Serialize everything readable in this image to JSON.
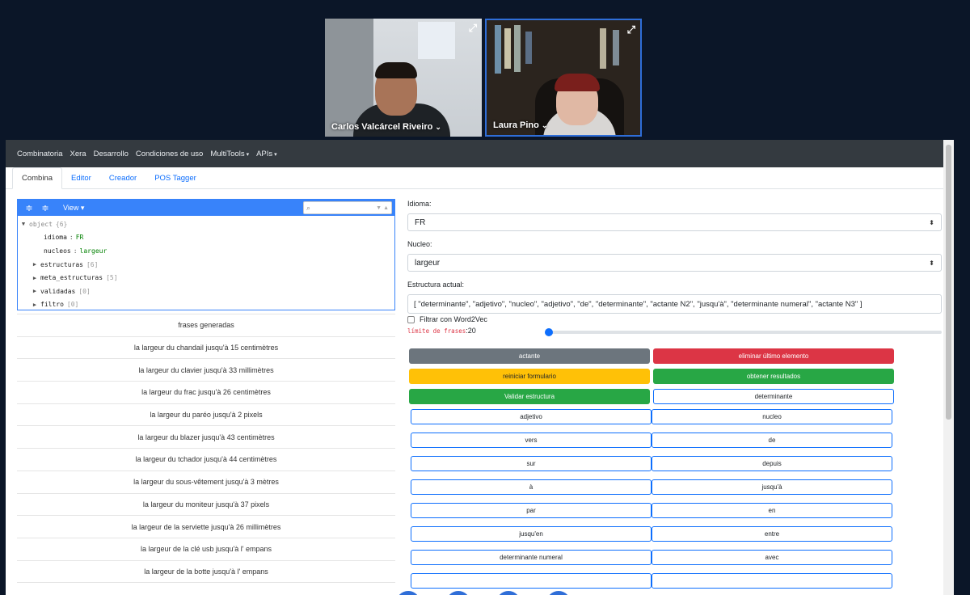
{
  "participants": [
    {
      "name": "Carlos Valcárcel Riveiro",
      "caret": "⌄"
    },
    {
      "name": "Laura Pino",
      "caret": "⌄"
    }
  ],
  "icons": {
    "expand": "⤢",
    "search": "⌕",
    "collapse_all": "≑",
    "expand_all": "≑",
    "sort_up": "▲",
    "sort_down": "▼",
    "select": "⬍",
    "tree_open": "▼",
    "tree_closed": "▶",
    "chevron": "▾"
  },
  "navbar": {
    "items": [
      "Combinatoria",
      "Xera",
      "Desarrollo",
      "Condiciones de uso",
      "MultiTools",
      "APIs"
    ]
  },
  "tabs": [
    "Combina",
    "Editor",
    "Creador",
    "POS Tagger"
  ],
  "json_editor": {
    "view_label": "View",
    "root": {
      "key": "object",
      "count": "{6}"
    },
    "fields": [
      {
        "key": "idioma",
        "value": "FR"
      },
      {
        "key": "nucleos",
        "value": "largeur"
      }
    ],
    "collapsed": [
      {
        "key": "estructuras",
        "count": "[6]"
      },
      {
        "key": "meta_estructuras",
        "count": "[5]"
      },
      {
        "key": "validadas",
        "count": "[0]"
      },
      {
        "key": "filtro",
        "count": "[0]"
      }
    ]
  },
  "results": {
    "header": "frases generadas",
    "rows": [
      "la largeur du chandail jusqu'à 15 centimètres",
      "la largeur du clavier jusqu'à 33 millimètres",
      "la largeur du frac jusqu'à 26 centimètres",
      "la largeur du paréo jusqu'à 2 pixels",
      "la largeur du blazer jusqu'à 43 centimètres",
      "la largeur du tchador jusqu'à 44 centimètres",
      "la largeur du sous-vêtement jusqu'à 3 mètres",
      "la largeur du moniteur jusqu'à 37 pixels",
      "la largeur de la serviette jusqu'à 26 millimètres",
      "la largeur de la clé usb jusqu'à l' empans",
      "la largeur de la botte jusqu'à l' empans"
    ]
  },
  "form": {
    "idioma_label": "Idioma:",
    "idioma_value": "FR",
    "nucleo_label": "Nucleo:",
    "nucleo_value": "largeur",
    "estructura_label": "Estructura actual:",
    "estructura_value": "[ \"determinante\", \"adjetivo\", \"nucleo\", \"adjetivo\", \"de\", \"determinante\", \"actante N2\", \"jusqu'à\", \"determinante numeral\", \"actante N3\" ]",
    "filtrar_label": "Filtrar con Word2Vec",
    "limite_label": "límite de frases",
    "limite_value": ":20",
    "limite_fraction": 0.0
  },
  "action_buttons": [
    [
      "actante",
      "eliminar último elemento"
    ],
    [
      "reiniciar formulario",
      "obtener resultados"
    ],
    [
      "Validar estructura",
      "determinante"
    ]
  ],
  "word_buttons": [
    [
      "adjetivo",
      "nucleo"
    ],
    [
      "vers",
      "de"
    ],
    [
      "sur",
      "depuis"
    ],
    [
      "à",
      "jusqu'à"
    ],
    [
      "par",
      "en"
    ],
    [
      "jusqu'en",
      "entre"
    ],
    [
      "determinante numeral",
      "avec"
    ]
  ]
}
